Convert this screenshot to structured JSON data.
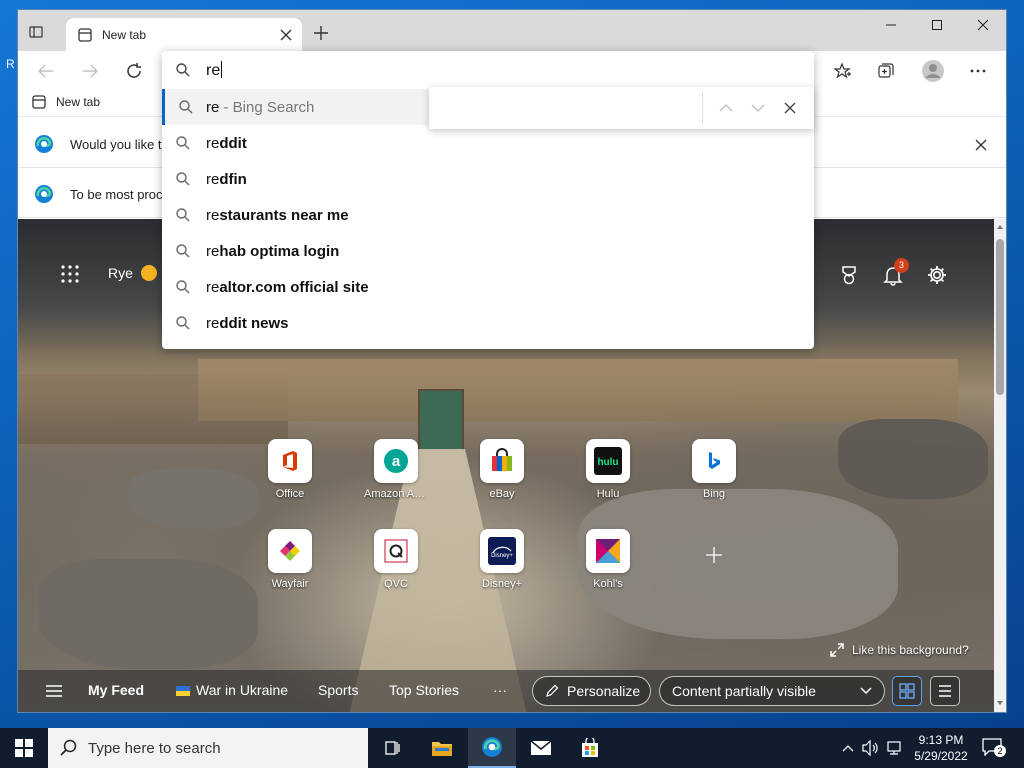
{
  "desktop": {
    "peek_text": "R"
  },
  "browser": {
    "tab": {
      "title": "New tab"
    },
    "favorites": [
      {
        "label": "New tab"
      }
    ],
    "infobars": [
      {
        "text": "Would you like t"
      },
      {
        "text": "To be most proc"
      }
    ],
    "address_bar": {
      "value": "re",
      "suggestions": [
        {
          "typed": "re",
          "rest": "",
          "suffix": " - Bing Search"
        },
        {
          "typed": "re",
          "rest": "ddit"
        },
        {
          "typed": "re",
          "rest": "dfin"
        },
        {
          "typed": "re",
          "rest": "staurants near me"
        },
        {
          "typed": "re",
          "rest": "hab optima login"
        },
        {
          "typed": "re",
          "rest": "altor.com official site"
        },
        {
          "typed": "re",
          "rest": "ddit news"
        }
      ]
    },
    "find_bar": {
      "value": ""
    },
    "new_tab_page": {
      "weather_location": "Rye",
      "notification_count": "3",
      "quick_links": [
        {
          "label": "Office",
          "icon": "office-icon",
          "color": "#d83b01"
        },
        {
          "label": "Amazon Assi...",
          "icon": "amazon-assistant-icon",
          "color": "#00a693"
        },
        {
          "label": "eBay",
          "icon": "ebay-icon",
          "color": "#e53238"
        },
        {
          "label": "Hulu",
          "icon": "hulu-icon",
          "color": "#1ce783"
        },
        {
          "label": "Bing",
          "icon": "bing-icon",
          "color": "#0a72d8"
        },
        {
          "label": "Wayfair",
          "icon": "wayfair-icon",
          "color": "#7f187f"
        },
        {
          "label": "QVC",
          "icon": "qvc-icon",
          "color": "#c8102e"
        },
        {
          "label": "Disney+",
          "icon": "disney-plus-icon",
          "color": "#0e1c55"
        },
        {
          "label": "Kohl's",
          "icon": "kohls-icon",
          "color": "#6d2077"
        }
      ],
      "like_background": "Like this background?",
      "feed": {
        "my_feed": "My Feed",
        "items": [
          "War in Ukraine",
          "Sports",
          "Top Stories"
        ],
        "more": "···",
        "personalize": "Personalize",
        "content_visibility": "Content partially visible"
      }
    }
  },
  "taskbar": {
    "search_placeholder": "Type here to search",
    "time": "9:13 PM",
    "date": "5/29/2022",
    "notification_count": "2"
  },
  "colors": {
    "accent": "#0a62c9",
    "taskbar": "#101d2f",
    "notification_badge": "#d33f1a"
  }
}
